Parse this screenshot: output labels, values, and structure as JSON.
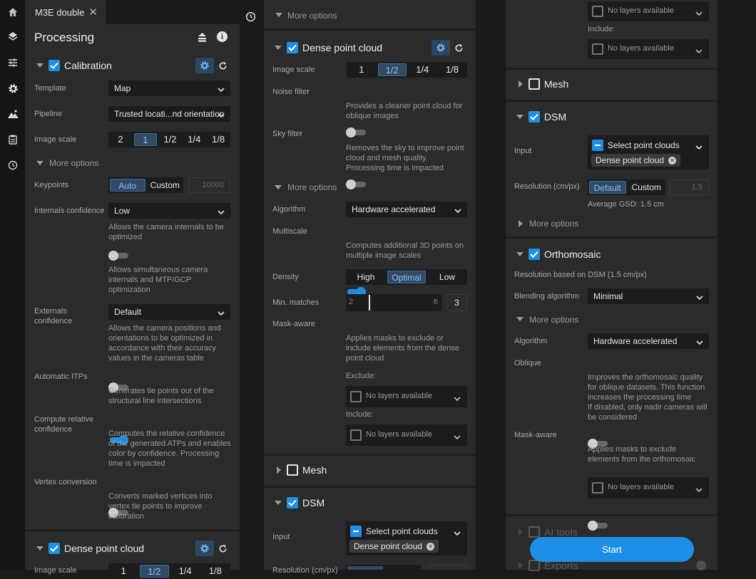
{
  "tab": {
    "title": "M3E double"
  },
  "rail": {
    "icons": [
      "home-icon",
      "layers-icon",
      "sliders-icon",
      "gear-icon",
      "terrain-icon",
      "clipboard-icon",
      "history-icon"
    ]
  },
  "history_icon": "history-icon",
  "p1": {
    "title": "Processing",
    "calibration": "Calibration",
    "template_label": "Template",
    "template_value": "Map",
    "pipeline_label": "Pipeline",
    "pipeline_value": "Trusted locati...nd orientation",
    "image_scale_label": "Image scale",
    "image_scale_options": [
      "2",
      "1",
      "1/2",
      "1/4",
      "1/8"
    ],
    "more_options": "More options",
    "keypoints_label": "Keypoints",
    "keypoints_auto": "Auto",
    "keypoints_custom": "Custom",
    "keypoints_placeholder": "10000",
    "internals_label": "Internals confidence",
    "internals_value": "Low",
    "internals_desc": "Allows the camera internals to be optimized",
    "simul_desc": "Allows simultaneous camera internals and MTP/GCP optimization",
    "externals_label": "Externals confidence",
    "externals_value": "Default",
    "externals_desc": "Allows the camera positions and orientations to be optimized in accordance with their accuracy values in the cameras table",
    "itps_label": "Automatic ITPs",
    "itps_desc": "Generates tie points out of the structural line intersections",
    "relconf_label": "Compute relative confidence",
    "relconf_desc": "Computes the relative confidence of the generated ATPs and enables color by confidence. Processing time is impacted",
    "vertex_label": "Vertex conversion",
    "vertex_desc": "Converts marked vertices into vertex tie points to improve calibration",
    "dense": "Dense point cloud",
    "image_scale_cut": "Image scale",
    "scale_cut": [
      "1",
      "1/2",
      "1/4",
      "1/8"
    ]
  },
  "p2": {
    "more_options_top": "More options",
    "dense": "Dense point cloud",
    "image_scale_label": "Image scale",
    "image_scale_options": [
      "1",
      "1/2",
      "1/4",
      "1/8"
    ],
    "noise_label": "Noise filter",
    "noise_desc": "Provides a cleaner point cloud for oblique images",
    "sky_label": "Sky filter",
    "sky_desc": "Removes the sky to improve point cloud and mesh quality. Processing time is impacted",
    "more_options": "More options",
    "algorithm_label": "Algorithm",
    "algorithm_value": "Hardware accelerated",
    "multiscale_label": "Multiscale",
    "multiscale_desc": "Computes additional 3D points on multiple image scales",
    "density_label": "Density",
    "density_options": [
      "High",
      "Optimal",
      "Low"
    ],
    "minmatch_label": "Min. matches",
    "minmatch_min": "2",
    "minmatch_max": "6",
    "minmatch_value": "3",
    "mask_label": "Mask-aware",
    "mask_desc": "Applies masks to exclude or include elements from the dense point cloud",
    "exclude_label": "Exclude:",
    "include_label": "Include:",
    "no_layers": "No layers available",
    "mesh": "Mesh",
    "dsm": "DSM",
    "input_label": "Input",
    "select_pc": "Select point clouds",
    "chip": "Dense point cloud",
    "res_cut": "Resolution (cm/px)"
  },
  "p3": {
    "no_layers": "No layers available",
    "include_label": "Include:",
    "mesh": "Mesh",
    "dsm": "DSM",
    "input_label": "Input",
    "select_pc": "Select point clouds",
    "chip": "Dense point cloud",
    "res_label": "Resolution (cm/px)",
    "res_default": "Default",
    "res_custom": "Custom",
    "res_placeholder": "1.5",
    "avg_gsd": "Average GSD: 1.5 cm",
    "more_options": "More options",
    "ortho": "Orthomosaic",
    "ortho_res": "Resolution based on DSM (1.5 cm/px)",
    "blend_label": "Blending algorithm",
    "blend_value": "Minimal",
    "algorithm_label": "Algorithm",
    "algorithm_value": "Hardware accelerated",
    "oblique_label": "Oblique",
    "oblique_desc": "Improves the orthomosaic quality for oblique datasets. This function increases the processing time\nIf disabled, only nadir cameras will be considered",
    "mask_label": "Mask-aware",
    "mask_desc": "Applies masks to exclude elements from the orthomosaic",
    "ai_tools": "AI tools",
    "exports": "Exports",
    "start": "Start"
  },
  "colors": {
    "accent": "#1e8fe6",
    "panel": "#2b2b2b",
    "bg": "#1a1a1a"
  }
}
